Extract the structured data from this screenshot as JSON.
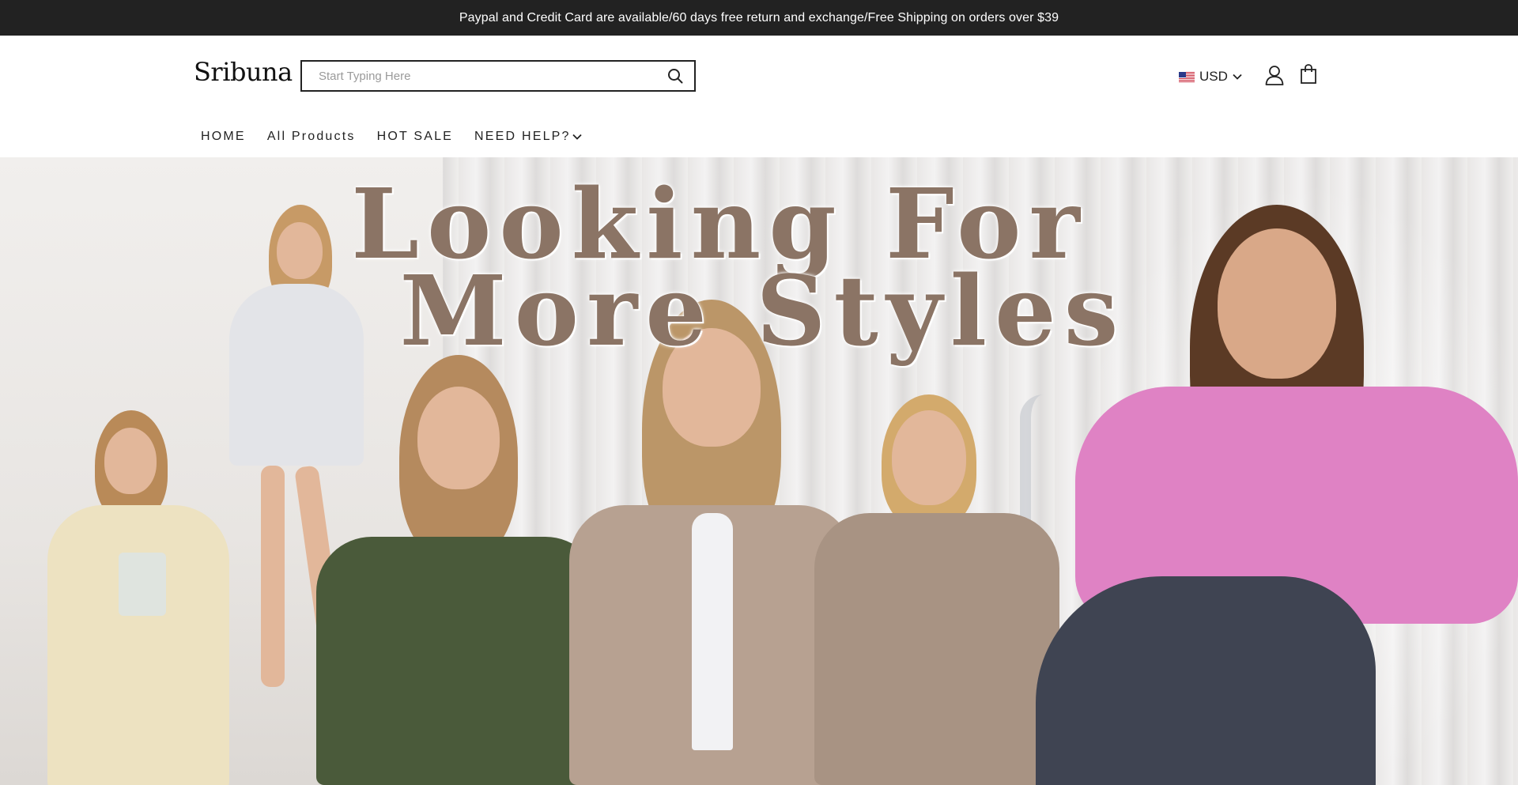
{
  "announcement": {
    "text": "Paypal and Credit Card are available/60 days free return and exchange/Free Shipping on orders over $39"
  },
  "header": {
    "logo": "Sribuna",
    "search": {
      "value": "",
      "placeholder": "Start Typing Here",
      "icon": "search-icon"
    },
    "currency": {
      "flag": "us-flag-icon",
      "value": "USD",
      "icon": "chevron-down-icon"
    },
    "account_icon": "user-icon",
    "cart_icon": "shopping-bag-icon"
  },
  "nav": {
    "items": [
      {
        "label": "HOME"
      },
      {
        "label": "All Products"
      },
      {
        "label": "HOT SALE"
      },
      {
        "label": "NEED HELP?",
        "icon": "chevron-down-icon"
      }
    ]
  },
  "hero": {
    "title_line1": "Looking For",
    "title_line2": "More Styles",
    "title_color": "#8b7465"
  },
  "colors": {
    "announcement_bg": "#222222",
    "announcement_text": "#ffffff",
    "search_border": "#222222"
  }
}
